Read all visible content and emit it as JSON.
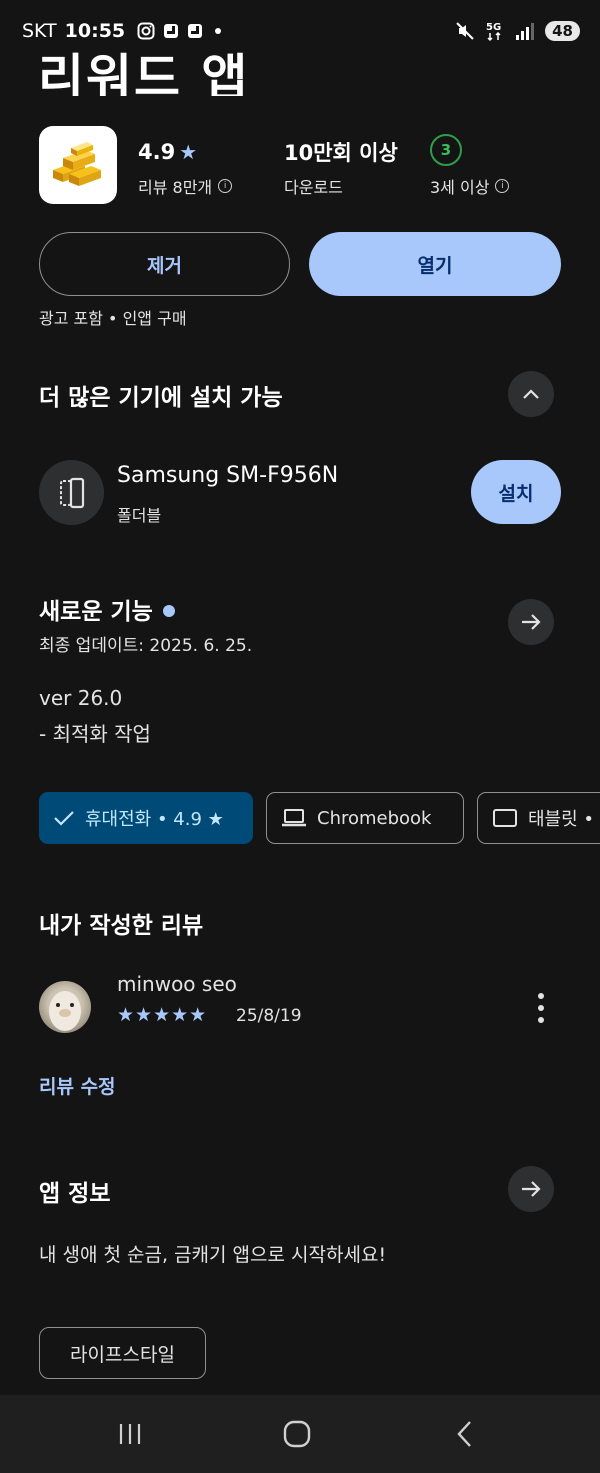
{
  "status_bar": {
    "carrier": "SKT",
    "time": "10:55",
    "battery": "48",
    "network": "5G"
  },
  "app": {
    "title_partial": "리워드 앱",
    "rating": "4.9",
    "reviews_label": "리뷰 8만개",
    "downloads": "10만회 이상",
    "downloads_label": "다운로드",
    "age_rating": "3",
    "age_label": "3세 이상",
    "icon": "gold-bars-icon"
  },
  "actions": {
    "remove_label": "제거",
    "open_label": "열기"
  },
  "ad_note": "광고 포함 • 인앱 구매",
  "more_devices": {
    "title": "더 많은 기기에 설치 가능",
    "device_name": "Samsung SM-F956N",
    "device_type": "폴더블",
    "install_label": "설치"
  },
  "whats_new": {
    "title": "새로운 기능",
    "updated": "최종 업데이트: 2025. 6. 25.",
    "version": "ver 26.0",
    "changes": "- 최적화 작업"
  },
  "device_chips": [
    {
      "label": "휴대전화 • 4.9 ★",
      "selected": true
    },
    {
      "label": "Chromebook",
      "selected": false
    },
    {
      "label": "태블릿 •",
      "selected": false
    }
  ],
  "my_review": {
    "title": "내가 작성한 리뷰",
    "author": "minwoo seo",
    "stars": "★★★★★",
    "date": "25/8/19",
    "edit_label": "리뷰 수정"
  },
  "app_info": {
    "title": "앱 정보",
    "description": "내 생애 첫 순금, 금캐기 앱으로 시작하세요!",
    "category": "라이프스타일"
  },
  "colors": {
    "background": "#141414",
    "accent": "#a8c7fa",
    "selected_chip": "#004a77",
    "age_badge": "#2e9e4a"
  }
}
